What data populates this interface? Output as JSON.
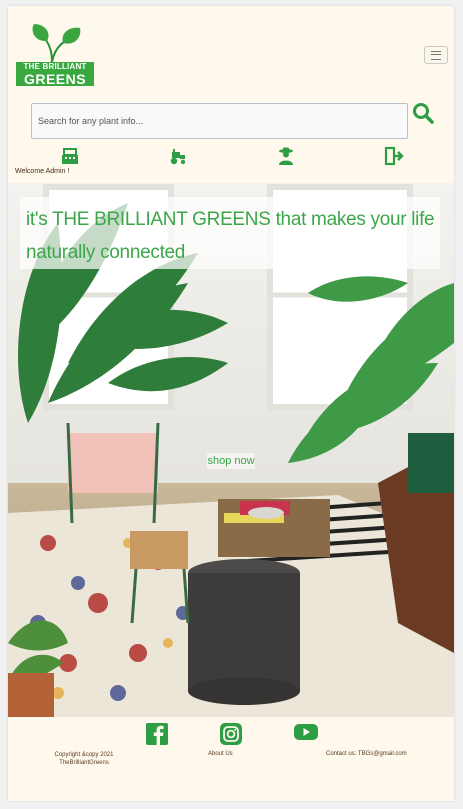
{
  "brand": {
    "line1": "THE BRILLIANT",
    "line2": "GREENS",
    "color": "#38a83f"
  },
  "header": {
    "menu_icon": "hamburger-icon",
    "search": {
      "placeholder": "Search for any plant info...",
      "value": "",
      "icon": "search-icon"
    },
    "nav_icons": [
      "cash-register-icon",
      "tractor-icon",
      "farmer-icon",
      "logout-icon"
    ],
    "welcome": "Welcome Admin !"
  },
  "hero": {
    "tagline": "it's THE BRILLIANT GREENS that makes your life naturally connected",
    "shop_label": "shop now",
    "accent": "#3ba64a"
  },
  "footer": {
    "copyright": "Copyright &copy 2021 TheBrilliantGreens",
    "about_label": "About Us",
    "contact": "Contact us: TBGs@gmail.com",
    "social_icons": [
      "facebook-icon",
      "instagram-icon",
      "youtube-icon"
    ]
  }
}
